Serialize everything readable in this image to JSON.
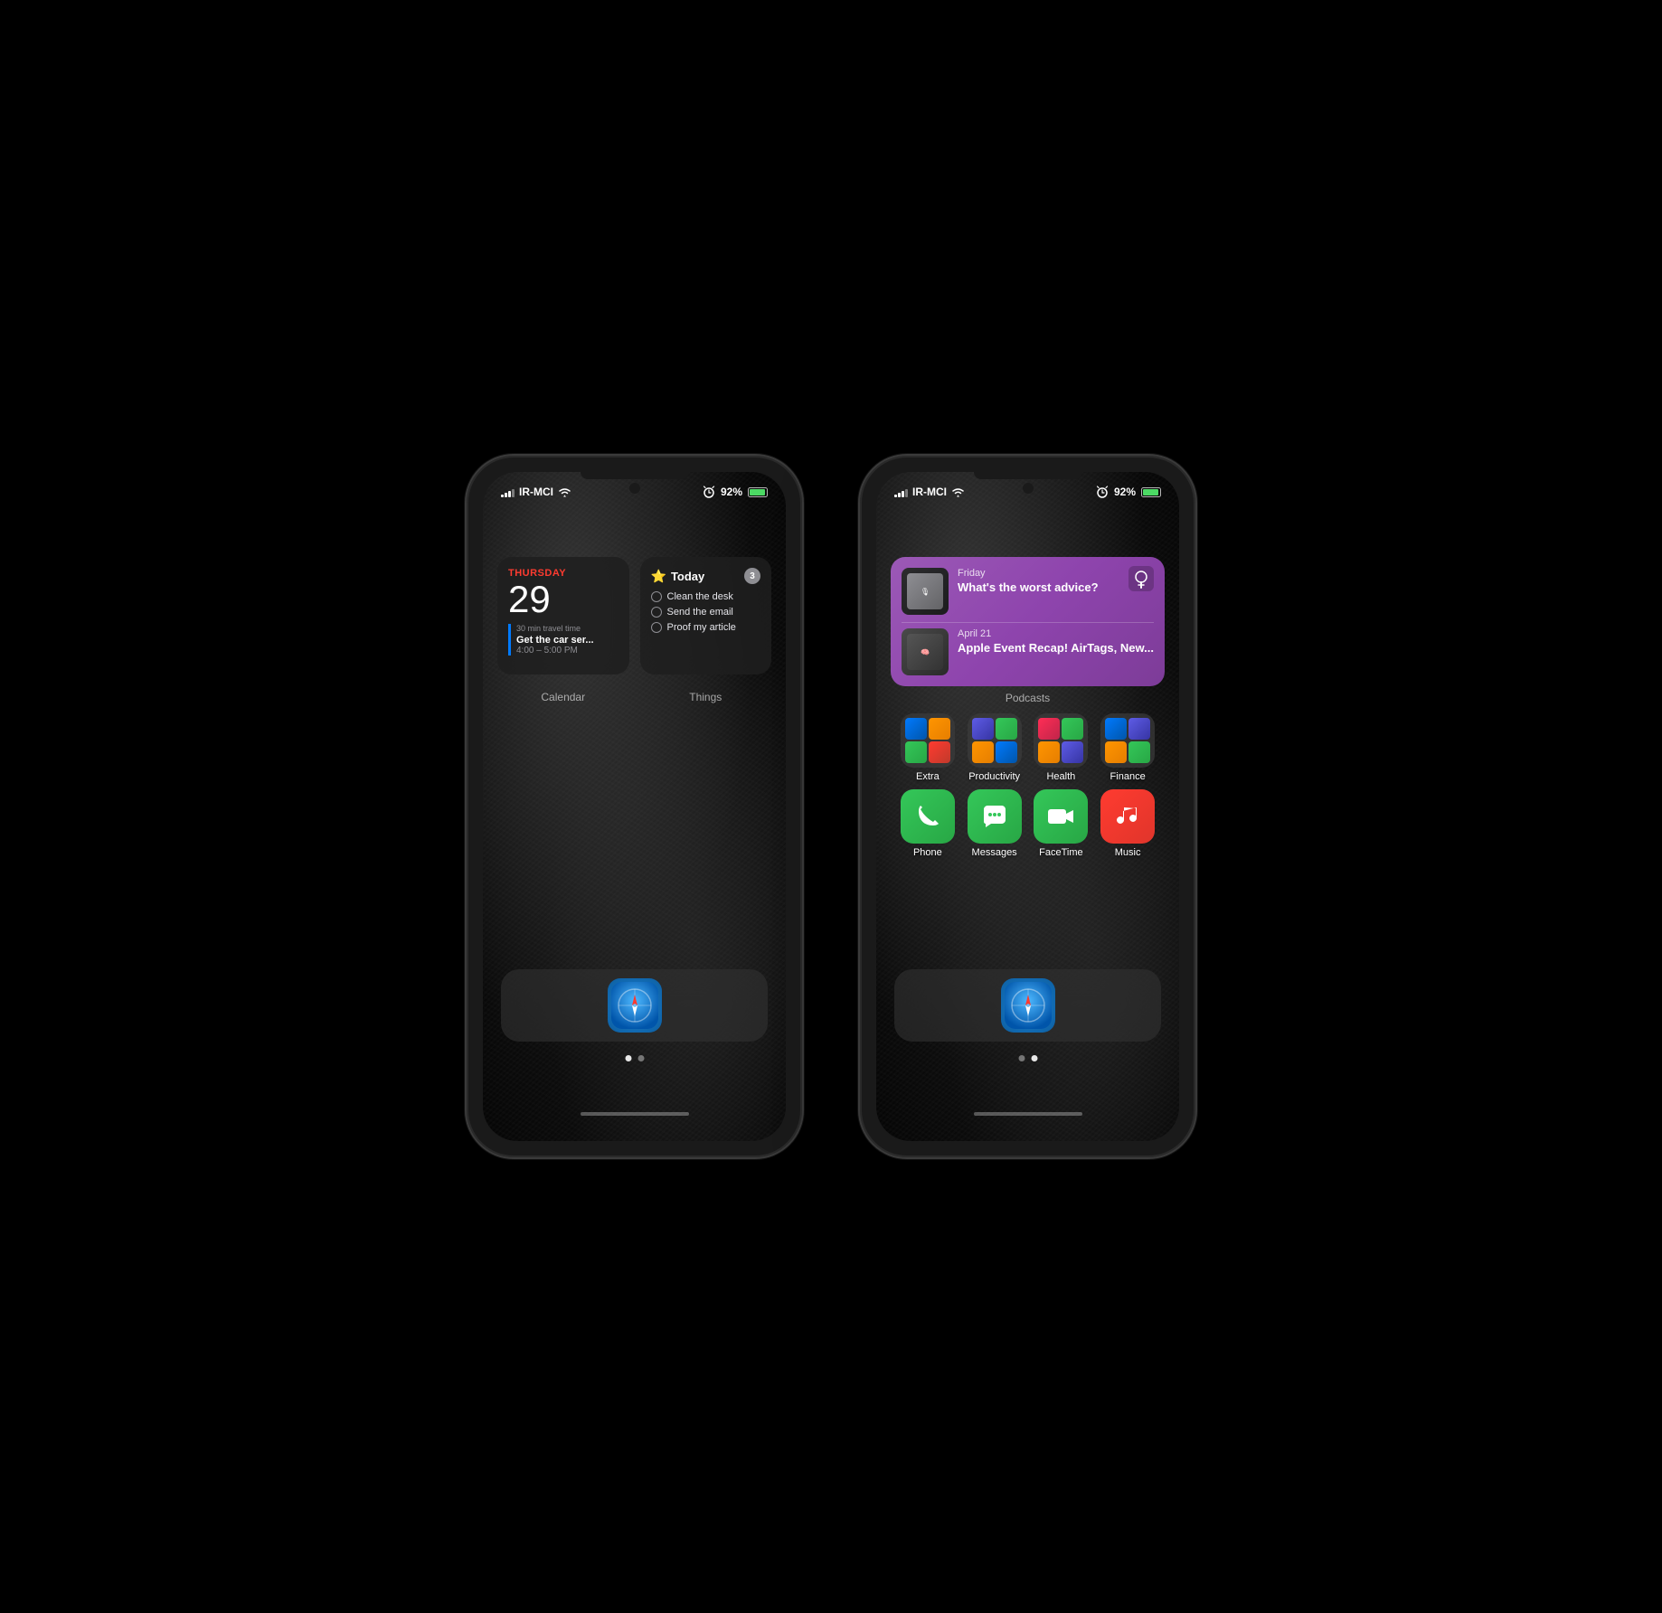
{
  "colors": {
    "background": "#000000",
    "phone_frame": "#1a1a1a",
    "wallpaper_dark": "#0a0a0a",
    "red_accent": "#ff3b30",
    "blue_accent": "#007aff",
    "green": "#34c759",
    "purple_podcast": "#9b59b6",
    "text_primary": "#ffffff",
    "text_secondary": "#8e8e93"
  },
  "phone1": {
    "status_bar": {
      "carrier": "IR-MCI",
      "wifi": true,
      "alarm": true,
      "battery": "92%",
      "charging": true
    },
    "calendar_widget": {
      "day_label": "THURSDAY",
      "date": "29",
      "travel_time": "30 min travel time",
      "event_title": "Get the car ser...",
      "event_time": "4:00 – 5:00 PM"
    },
    "things_widget": {
      "title": "Today",
      "badge": "3",
      "items": [
        "Clean the desk",
        "Send the email",
        "Proof my article"
      ]
    },
    "widget_labels": {
      "calendar": "Calendar",
      "things": "Things"
    },
    "dock": {
      "app": "Safari"
    },
    "page_dots": [
      {
        "active": true
      },
      {
        "active": false
      }
    ]
  },
  "phone2": {
    "status_bar": {
      "carrier": "IR-MCI",
      "wifi": true,
      "alarm": true,
      "battery": "92%",
      "charging": true
    },
    "podcast_widget": {
      "label": "Podcasts",
      "episode1": {
        "date": "Friday",
        "title": "What's the worst advice?"
      },
      "episode2": {
        "date": "April 21",
        "title": "Apple Event Recap! AirTags, New..."
      }
    },
    "folders": [
      {
        "label": "Extra"
      },
      {
        "label": "Productivity"
      },
      {
        "label": "Health"
      },
      {
        "label": "Finance"
      }
    ],
    "apps": [
      {
        "label": "Phone",
        "type": "phone"
      },
      {
        "label": "Messages",
        "type": "messages"
      },
      {
        "label": "FaceTime",
        "type": "facetime"
      },
      {
        "label": "Music",
        "type": "music"
      }
    ],
    "dock": {
      "app": "Safari"
    },
    "page_dots": [
      {
        "active": false
      },
      {
        "active": true
      }
    ]
  }
}
